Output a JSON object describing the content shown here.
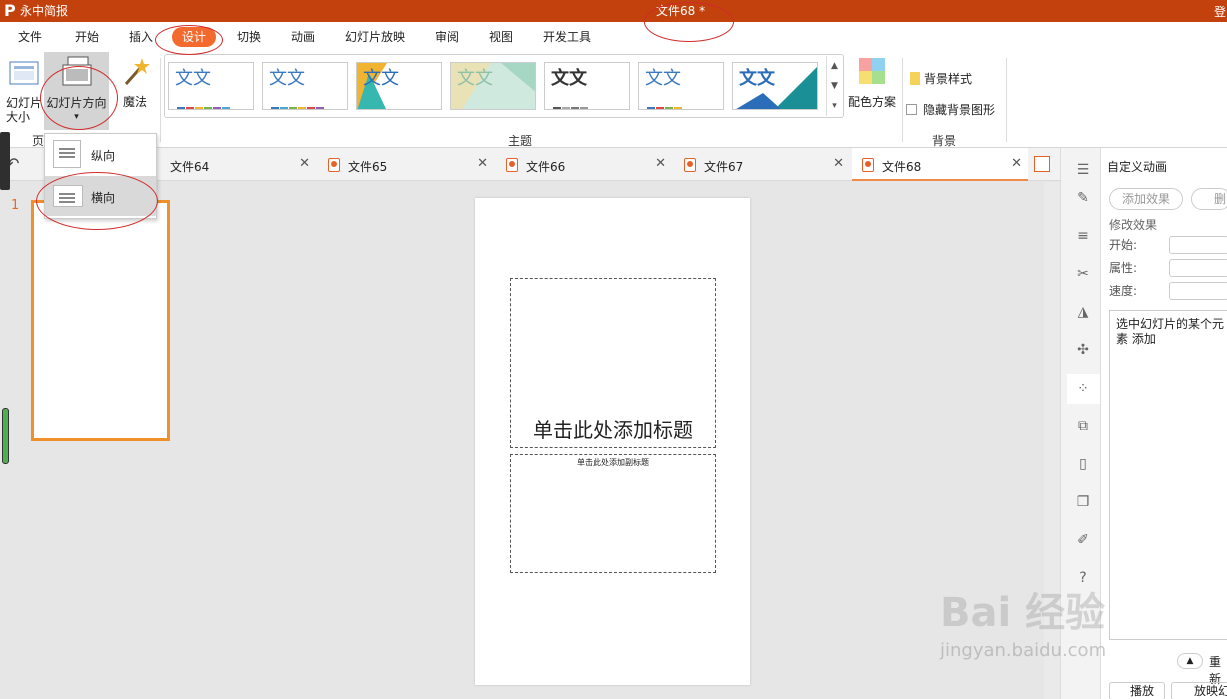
{
  "app": {
    "name": "永中简报",
    "logo": "P",
    "doc_title": "文件68 *",
    "login": "登"
  },
  "menu": [
    "文件",
    "开始",
    "插入",
    "设计",
    "切换",
    "动画",
    "幻灯片放映",
    "审阅",
    "视图",
    "开发工具"
  ],
  "ribbon": {
    "slide_size": "幻灯片大小",
    "slide_size_arrow": "▾",
    "orientation": "幻灯片方向",
    "orientation_arrow": "▾",
    "magic": "魔法",
    "page_group": "页",
    "theme_group": "主题",
    "color_scheme": "配色方案",
    "bg_style": "背景样式",
    "hide_bg": "隐藏背景图形",
    "bg_group": "背景",
    "theme_text": "文文"
  },
  "dropdown": {
    "portrait": "纵向",
    "landscape": "横向"
  },
  "tabs": [
    {
      "label": "文件64"
    },
    {
      "label": "文件65"
    },
    {
      "label": "文件66"
    },
    {
      "label": "文件67"
    },
    {
      "label": "文件68"
    }
  ],
  "thumb_number": "1",
  "slide": {
    "title_ph": "单击此处添加标题",
    "subtitle_ph": "单击此处添加副标题"
  },
  "right_panel": {
    "title": "自定义动画",
    "add_effect": "添加效果",
    "delete": "删",
    "modify": "修改效果",
    "start": "开始:",
    "property": "属性:",
    "speed": "速度:",
    "hint": "选中幻灯片的某个元素 添加",
    "reorder": "重新",
    "play": "播放",
    "slideshow": "放映幻"
  },
  "watermark": {
    "brand": "Bai 经验",
    "url": "jingyan.baidu.com"
  },
  "colors": {
    "titlebar": "#c2410c",
    "accent": "#f46a2e",
    "annotation": "#d12b2b"
  }
}
